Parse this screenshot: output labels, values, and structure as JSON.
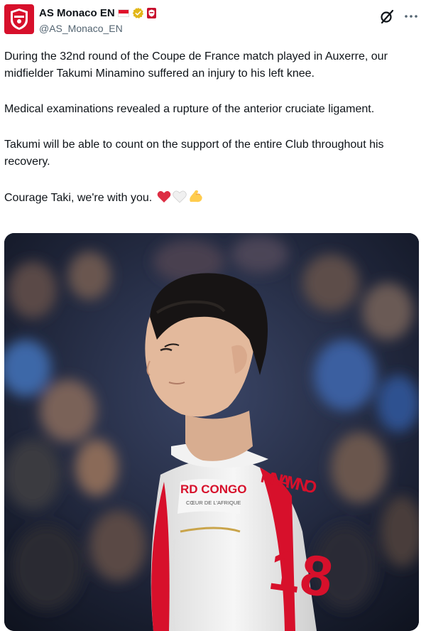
{
  "author": {
    "display_name": "AS Monaco EN",
    "handle": "@AS_Monaco_EN",
    "avatar_icon": "as-monaco-crest-icon",
    "verified_icon": "gold-verified-badge-icon",
    "affiliation_icon": "monaco-affiliate-badge-icon",
    "flag_icon": "monaco-flag-icon"
  },
  "toolbar": {
    "grok_icon": "grok-icon",
    "more_icon": "more-options-icon"
  },
  "tweet": {
    "paragraphs": [
      "During the 32nd round of the Coupe de France match played in Auxerre, our midfielder Takumi Minamino suffered an injury to his left knee.",
      "Medical examinations revealed a rupture of the anterior cruciate ligament.",
      "Takumi will be able to count on the support of the entire Club throughout his recovery.",
      "Courage Taki, we're with you."
    ],
    "emojis": [
      "red-heart-icon",
      "white-heart-icon",
      "flexed-biceps-icon"
    ]
  },
  "media": {
    "jersey_sponsor": "RD CONGO",
    "jersey_sponsor_sub": "CŒUR DE L'AFRIQUE",
    "jersey_name": "MINAMINO",
    "jersey_number": "18",
    "colors": {
      "red": "#d7102b",
      "white": "#f4f4f4",
      "hair": "#161414",
      "skin": "#e3b99c"
    }
  }
}
